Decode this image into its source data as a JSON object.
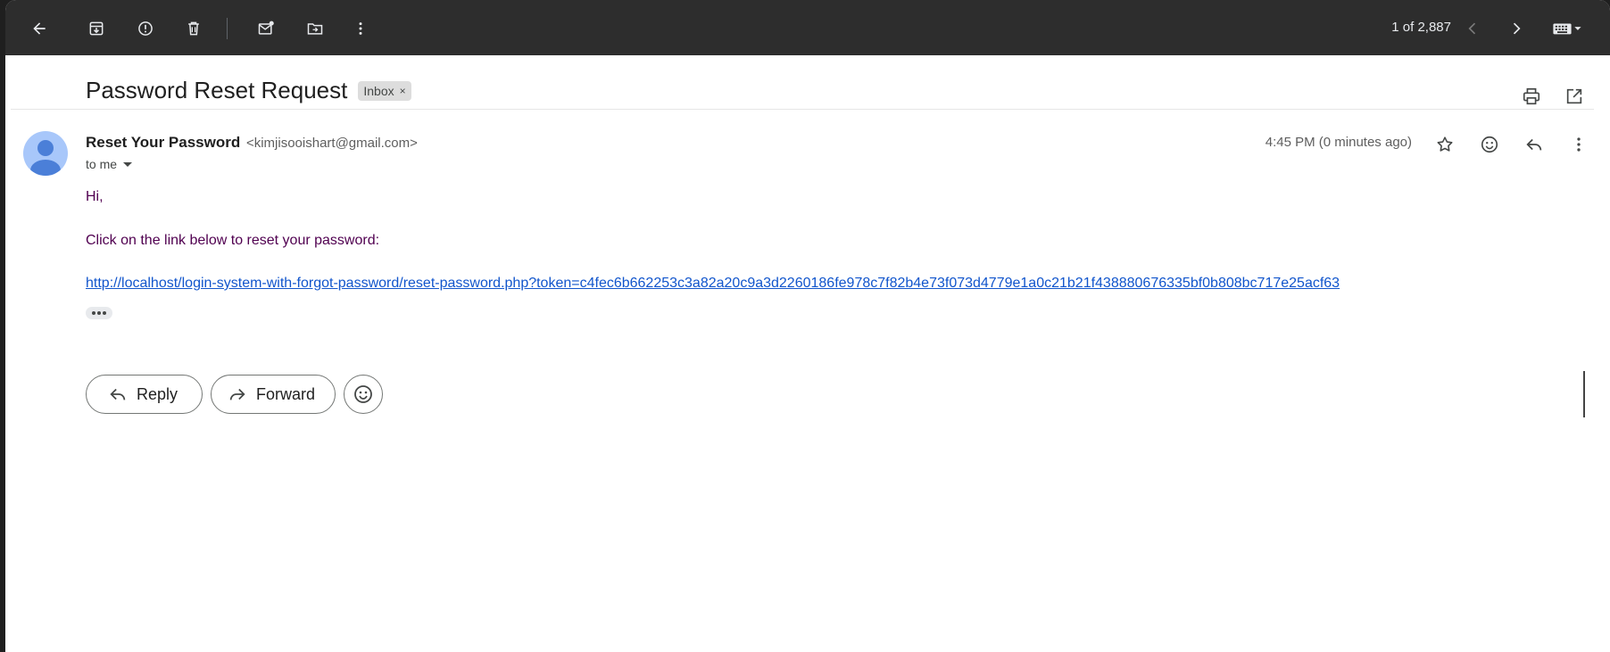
{
  "toolbar": {
    "pager_count": "1 of 2,887",
    "icons": {
      "back": "arrow-left-icon",
      "archive": "archive-icon",
      "spam": "report-spam-icon",
      "delete": "trash-icon",
      "mark_unread": "mark-unread-icon",
      "move": "move-to-folder-icon",
      "more": "more-vertical-icon",
      "prev": "chevron-left-icon",
      "next": "chevron-right-icon",
      "keyboard": "keyboard-icon"
    }
  },
  "email": {
    "subject": "Password Reset Request",
    "label": "Inbox",
    "label_remove": "×",
    "sender_name": "Reset Your Password",
    "sender_email": "<kimjisooishart@gmail.com>",
    "to": "to me",
    "timestamp": "4:45 PM (0 minutes ago)",
    "body": {
      "greeting": "Hi,",
      "instruction": "Click on the link below to reset your password:",
      "link": "http://localhost/login-system-with-forgot-password/reset-password.php?token=c4fec6b662253c3a82a20c9a3d2260186fe978c7f82b4e73f073d4779e1a0c21b21f438880676335bf0b808bc717e25acf63"
    }
  },
  "actions": {
    "reply": "Reply",
    "forward": "Forward"
  },
  "colors": {
    "toolbar_bg": "#2d2d2d",
    "body_text": "#500050",
    "link": "#1155cc",
    "avatar_bg": "#a8c7fa",
    "avatar_fg": "#4b7fd8"
  }
}
